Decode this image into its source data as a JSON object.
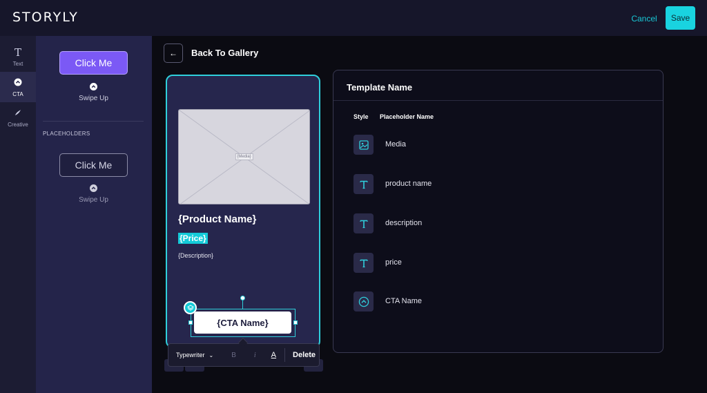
{
  "app": {
    "logo": "STORYLY"
  },
  "topbar": {
    "cancel_label": "Cancel",
    "save_label": "Save"
  },
  "rail": {
    "items": [
      {
        "label": "Text",
        "icon": "text-icon",
        "active": false
      },
      {
        "label": "CTA",
        "icon": "cta-icon",
        "active": true
      },
      {
        "label": "Creative",
        "icon": "brush-icon",
        "active": false
      }
    ]
  },
  "panel": {
    "cta_button_label": "Click Me",
    "cta_swipe_label": "Swipe Up",
    "section_heading": "PLACEHOLDERS",
    "placeholder_button_label": "Click Me",
    "placeholder_swipe_label": "Swipe Up"
  },
  "header": {
    "back_label": "Back To Gallery"
  },
  "story": {
    "media_tag": "{Media}",
    "product_name": "{Product Name}",
    "price": "{Price}",
    "description": "{Description}",
    "cta_name": "{CTA Name}"
  },
  "toolbar": {
    "font_name": "Typewriter",
    "bold_label": "B",
    "italic_label": "i",
    "color_label": "A",
    "delete_label": "Delete"
  },
  "template": {
    "title": "Template Name",
    "columns": [
      "Style",
      "Placeholder Name"
    ],
    "rows": [
      {
        "icon": "image-icon",
        "name": "Media"
      },
      {
        "icon": "text-icon",
        "name": "product name"
      },
      {
        "icon": "text-icon",
        "name": "description"
      },
      {
        "icon": "text-icon",
        "name": "price"
      },
      {
        "icon": "chevron-up-circle-icon",
        "name": "CTA Name"
      }
    ]
  },
  "colors": {
    "accent": "#19d3e0",
    "primary_purple": "#7b59f5",
    "panel_bg": "#24244a",
    "story_bg": "#26264d"
  }
}
